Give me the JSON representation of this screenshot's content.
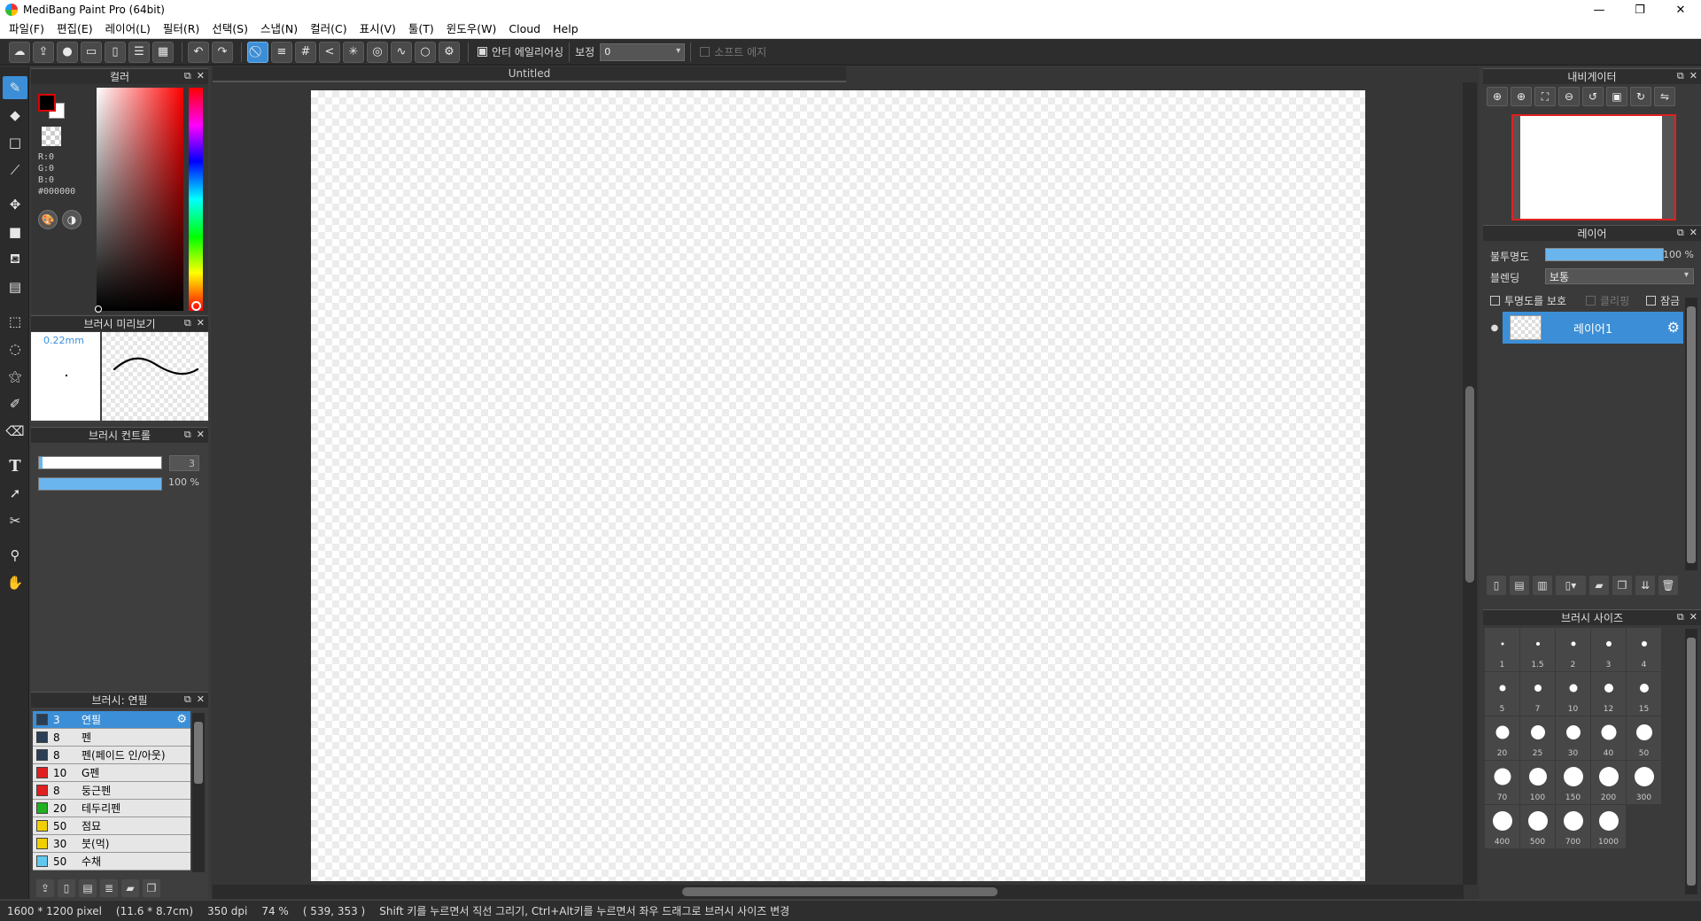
{
  "window": {
    "title": "MediBang Paint Pro (64bit)",
    "minimize": "—",
    "maximize": "❐",
    "close": "✕"
  },
  "menu": [
    "파일(F)",
    "편집(E)",
    "레이어(L)",
    "필터(R)",
    "선택(S)",
    "스냅(N)",
    "컬러(C)",
    "표시(V)",
    "툴(T)",
    "윈도우(W)",
    "Cloud",
    "Help"
  ],
  "toolbar": {
    "antialias_label": "안티 에일리어싱",
    "antialias_checked": true,
    "correction_label": "보정",
    "correction_value": "0",
    "soft_edge_label": "소프트 에지",
    "soft_edge_checked": false
  },
  "panels": {
    "color": {
      "title": "컬러",
      "r": "R:0",
      "g": "G:0",
      "b": "B:0",
      "hex": "#000000",
      "foreground": "#000000",
      "background": "#ffffff"
    },
    "brush_preview": {
      "title": "브러시 미리보기",
      "size_label": "0.22mm"
    },
    "brush_control": {
      "title": "브러시 컨트롤",
      "size_value": "3",
      "opacity_value": "100 %",
      "size_fraction": 0.03,
      "opacity_fraction": 1.0
    },
    "brush_list": {
      "title": "브러시: 연필",
      "items": [
        {
          "size": "3",
          "name": "연필",
          "color": "#2a3f55",
          "selected": true
        },
        {
          "size": "8",
          "name": "펜",
          "color": "#2a3f55",
          "selected": false
        },
        {
          "size": "8",
          "name": "펜(페이드 인/아웃)",
          "color": "#2a3f55",
          "selected": false
        },
        {
          "size": "10",
          "name": "G펜",
          "color": "#e02020",
          "selected": false
        },
        {
          "size": "8",
          "name": "둥근펜",
          "color": "#e02020",
          "selected": false
        },
        {
          "size": "20",
          "name": "테두리펜",
          "color": "#20b020",
          "selected": false
        },
        {
          "size": "50",
          "name": "점묘",
          "color": "#f0d000",
          "selected": false
        },
        {
          "size": "30",
          "name": "붓(먹)",
          "color": "#f0d000",
          "selected": false
        },
        {
          "size": "50",
          "name": "수채",
          "color": "#60c8f0",
          "selected": false
        }
      ]
    },
    "navigator": {
      "title": "내비게이터"
    },
    "layer": {
      "title": "레이어",
      "opacity_label": "불투명도",
      "opacity_value": "100 %",
      "blend_label": "블렌딩",
      "blend_value": "보통",
      "protect_alpha_label": "투명도를 보호",
      "clipping_label": "클리핑",
      "lock_label": "잠금",
      "layers": [
        {
          "name": "레이어1",
          "selected": true
        }
      ]
    },
    "brush_size": {
      "title": "브러시 사이즈",
      "sizes": [
        "1",
        "1.5",
        "2",
        "3",
        "4",
        "5",
        "7",
        "10",
        "12",
        "15",
        "20",
        "25",
        "30",
        "40",
        "50",
        "70",
        "100",
        "150",
        "200",
        "300",
        "400",
        "500",
        "700",
        "1000"
      ]
    }
  },
  "document": {
    "tab_title": "Untitled"
  },
  "status": {
    "dimensions": "1600 * 1200 pixel",
    "physical": "(11.6 * 8.7cm)",
    "dpi": "350 dpi",
    "zoom": "74 %",
    "cursor": "( 539, 353 )",
    "hint": "Shift 키를 누르면서 직선 그리기, Ctrl+Alt키를 누르면서 좌우 드래그로 브러시 사이즈 변경"
  },
  "icons": {
    "toolbar": [
      "cloud-icon",
      "share-icon",
      "comment-icon",
      "speech-icon",
      "page-icon",
      "list-icon",
      "grid-icon",
      "undo-icon",
      "redo-icon",
      "snap-off-icon",
      "parallel-snap-icon",
      "cross-snap-icon",
      "vanishing-point-icon",
      "radial-snap-icon",
      "concentric-snap-icon",
      "curve-snap-icon",
      "circle-snap-icon",
      "snap-settings-icon"
    ],
    "tools": [
      "brush-icon",
      "eraser-icon",
      "dot-icon",
      "line-icon",
      "move-icon",
      "fill-rect-icon",
      "bucket-icon",
      "gradient-icon",
      "select-rect-icon",
      "lasso-icon",
      "magic-wand-icon",
      "select-pen-icon",
      "select-eraser-icon",
      "text-icon",
      "operation-icon",
      "divide-icon",
      "eyedropper-icon",
      "hand-icon"
    ]
  }
}
